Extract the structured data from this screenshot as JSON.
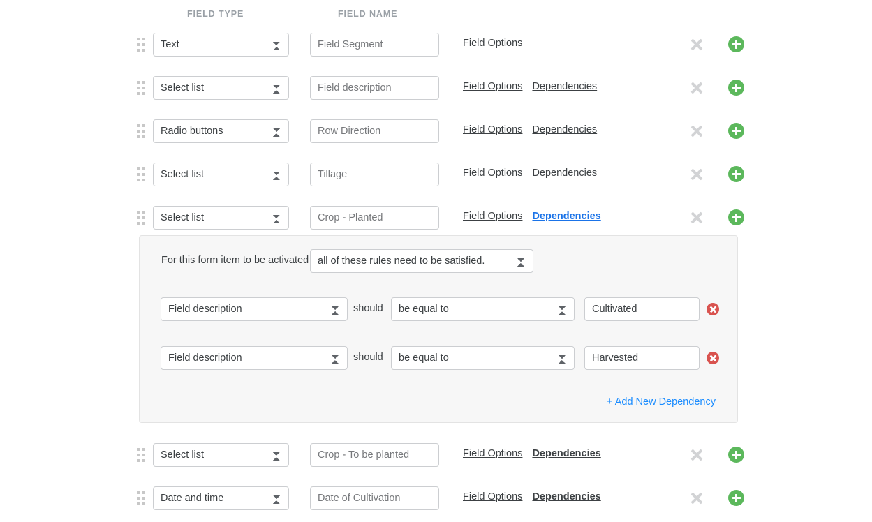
{
  "columns": {
    "field_type": "FIELD TYPE",
    "field_name": "FIELD NAME"
  },
  "icons": {
    "drag": "drag-handle-icon",
    "remove": "remove-x-icon",
    "add": "add-plus-icon",
    "delete": "delete-circle-icon",
    "select_arrows": "chevron-updown-icon"
  },
  "colors": {
    "add_green": "#5cb85c",
    "delete_red": "#d9534f",
    "link_blue": "#1a73e8",
    "add_link_blue": "#1a8cff",
    "panel_bg": "#f7f7f7"
  },
  "links": {
    "field_options": "Field Options",
    "dependencies": "Dependencies"
  },
  "rows": [
    {
      "field_type": "Text",
      "field_name": "Field Segment",
      "has_dependencies_link": false,
      "dependencies_bold": false,
      "dependencies_active": false
    },
    {
      "field_type": "Select list",
      "field_name": "Field description",
      "has_dependencies_link": true,
      "dependencies_bold": false,
      "dependencies_active": false
    },
    {
      "field_type": "Radio buttons",
      "field_name": "Row Direction",
      "has_dependencies_link": true,
      "dependencies_bold": false,
      "dependencies_active": false
    },
    {
      "field_type": "Select list",
      "field_name": "Tillage",
      "has_dependencies_link": true,
      "dependencies_bold": false,
      "dependencies_active": false
    },
    {
      "field_type": "Select list",
      "field_name": "Crop - Planted",
      "has_dependencies_link": true,
      "dependencies_bold": true,
      "dependencies_active": true
    },
    {
      "field_type": "Select list",
      "field_name": "Crop - To be planted",
      "has_dependencies_link": true,
      "dependencies_bold": true,
      "dependencies_active": false
    },
    {
      "field_type": "Date and time",
      "field_name": "Date of Cultivation",
      "has_dependencies_link": true,
      "dependencies_bold": true,
      "dependencies_active": false
    }
  ],
  "dependency_panel": {
    "intro_label": "For this form item to be activated",
    "mode": "all of these rules need to be satisfied.",
    "should_label": "should",
    "add_link": "+ Add New Dependency",
    "rules": [
      {
        "field": "Field description",
        "operator": "be equal to",
        "value": "Cultivated"
      },
      {
        "field": "Field description",
        "operator": "be equal to",
        "value": "Harvested"
      }
    ]
  }
}
